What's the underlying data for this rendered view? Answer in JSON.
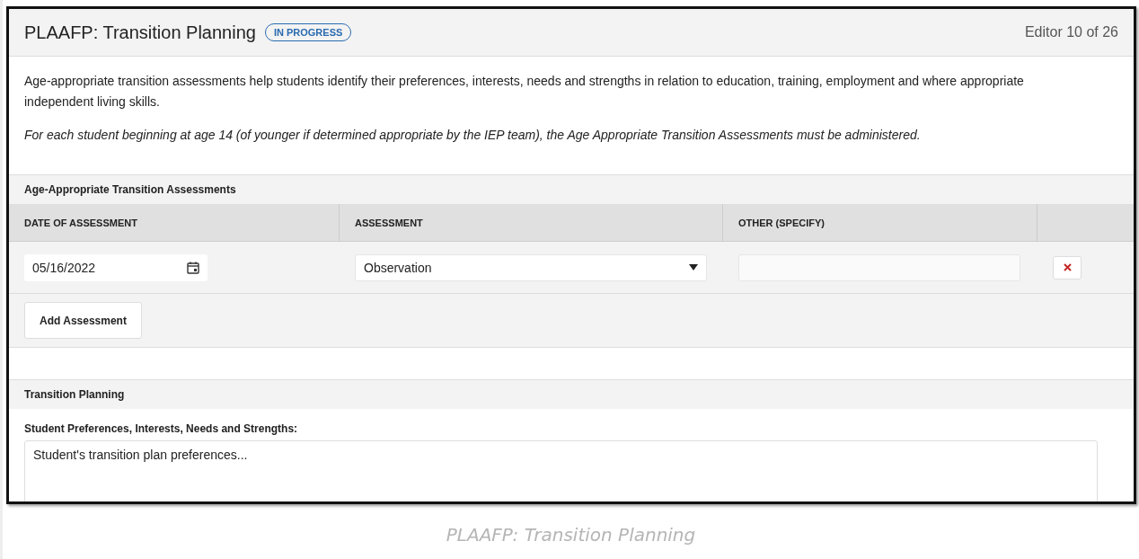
{
  "header": {
    "title": "PLAAFP: Transition Planning",
    "status": "IN PROGRESS",
    "counter": "Editor 10 of 26"
  },
  "intro": [
    {
      "kind": "plain",
      "text": "Age-appropriate transition assessments help students identify their preferences, interests, needs and strengths in relation to education, training, employment and where appropriate independent living skills."
    },
    {
      "kind": "italic",
      "text": "For each student beginning at age 14 (of younger if determined appropriate by the IEP team), the Age Appropriate Transition Assessments must be administered."
    }
  ],
  "assessments": {
    "title": "Age-Appropriate Transition Assessments",
    "columns": [
      "DATE OF ASSESSMENT",
      "ASSESSMENT",
      "OTHER (SPECIFY)"
    ],
    "rows": [
      {
        "date": "05/16/2022",
        "assessment": "Observation"
      }
    ],
    "add_button": "Add Assessment"
  },
  "transition_planning": {
    "title": "Transition Planning",
    "field_label": "Student Preferences, Interests, Needs and Strengths:",
    "field_value": "Student's transition plan preferences..."
  },
  "caption": "PLAAFP: Transition Planning"
}
